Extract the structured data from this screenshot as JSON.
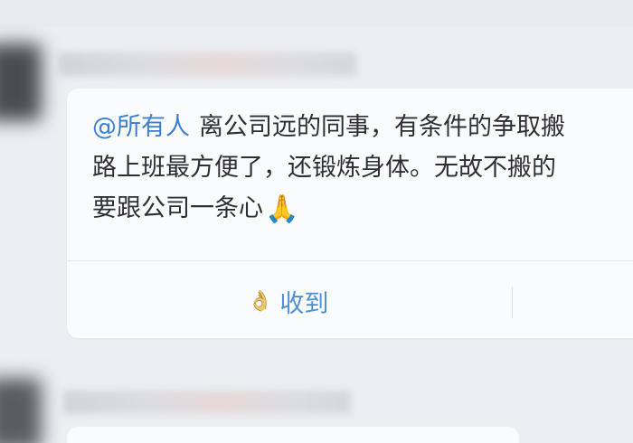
{
  "message": {
    "mention": "@所有人",
    "lines": [
      "离公司远的同事，有条件的争取搬",
      "路上班最方便了，还锻炼身体。无故不搬的",
      "要跟公司一条心"
    ],
    "emoji": "🙏"
  },
  "reaction": {
    "icon": "👌",
    "label": "收到"
  },
  "colors": {
    "mention": "#3f7fd0",
    "action": "#4f8fd6",
    "background": "#eceef2",
    "bubble": "#fafbfc"
  }
}
